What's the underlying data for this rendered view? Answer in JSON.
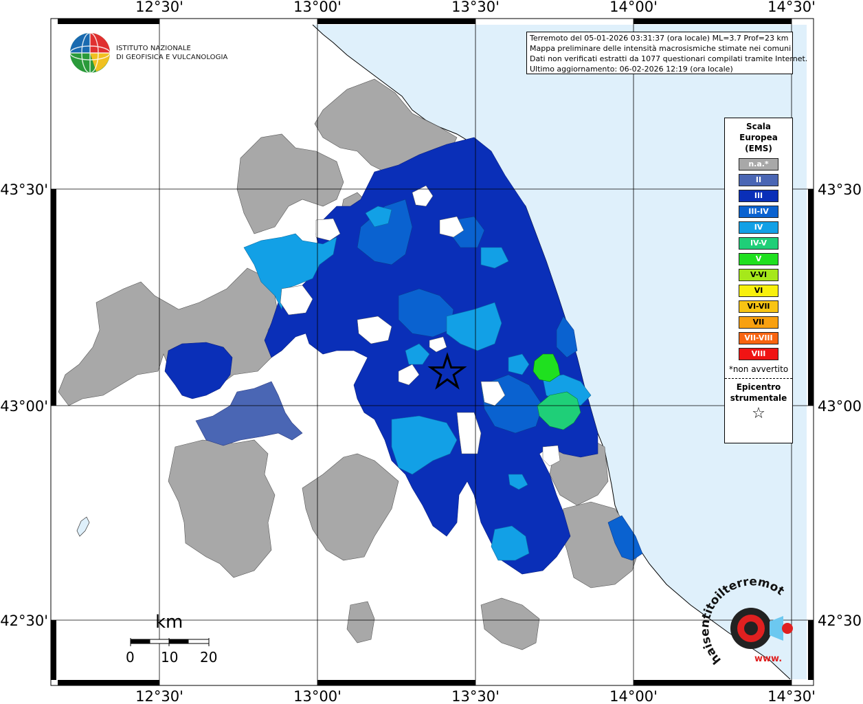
{
  "coords": {
    "top": [
      "12°30'",
      "13°00'",
      "13°30'",
      "14°00'",
      "14°30'"
    ],
    "bottom": [
      "12°30'",
      "13°00'",
      "13°30'",
      "14°00'",
      "14°30'"
    ],
    "left": [
      "43°30'",
      "43°00'",
      "42°30'"
    ],
    "right": [
      "43°30'",
      "43°00'",
      "42°30'"
    ]
  },
  "logo": {
    "line1": "ISTITUTO NAZIONALE",
    "line2": "DI GEOFISICA E VULCANOLOGIA"
  },
  "info": {
    "line1": "Terremoto del 05-01-2026 03:31:37 (ora locale) ML=3.7 Prof=23 km",
    "line2": "Mappa preliminare delle intensità macrosismiche stimate nei comuni",
    "line3": "Dati non verificati estratti da 1077 questionari compilati tramite Internet.",
    "line4": "Ultimo aggiornamento: 06-02-2026 12:19 (ora locale)"
  },
  "legend": {
    "title1": "Scala",
    "title2": "Europea",
    "title3": "(EMS)",
    "items": [
      {
        "label": "n.a.*",
        "color": "#a8a8a8"
      },
      {
        "label": "II",
        "color": "#4a66b4"
      },
      {
        "label": "III",
        "color": "#0a2fb8"
      },
      {
        "label": "III-IV",
        "color": "#0a62d0"
      },
      {
        "label": "IV",
        "color": "#12a0e6"
      },
      {
        "label": "IV-V",
        "color": "#1fcf78"
      },
      {
        "label": "V",
        "color": "#1fe01f"
      },
      {
        "label": "V-VI",
        "color": "#a6e81a"
      },
      {
        "label": "VI",
        "color": "#f8f00c"
      },
      {
        "label": "VI-VII",
        "color": "#f8c414"
      },
      {
        "label": "VII",
        "color": "#f8a010"
      },
      {
        "label": "VII-VIII",
        "color": "#f86410"
      },
      {
        "label": "VIII",
        "color": "#f01414"
      }
    ],
    "note": "*non avvertito",
    "epicentre1": "Epicentro",
    "epicentre2": "strumentale",
    "star": "☆"
  },
  "scale": {
    "unit": "km",
    "labels": [
      "0",
      "10",
      "20"
    ]
  },
  "watermark": {
    "text": "haisentitoilterremoto.it",
    "url": "www."
  },
  "colors": {
    "sea": "#dff0fb",
    "land": "#ffffff",
    "na": "#a8a8a8",
    "II": "#4a66b4",
    "III": "#0a2fb8",
    "III_IV": "#0a62d0",
    "IV": "#12a0e6",
    "IV_V": "#1fcf78",
    "V": "#1fe01f"
  }
}
